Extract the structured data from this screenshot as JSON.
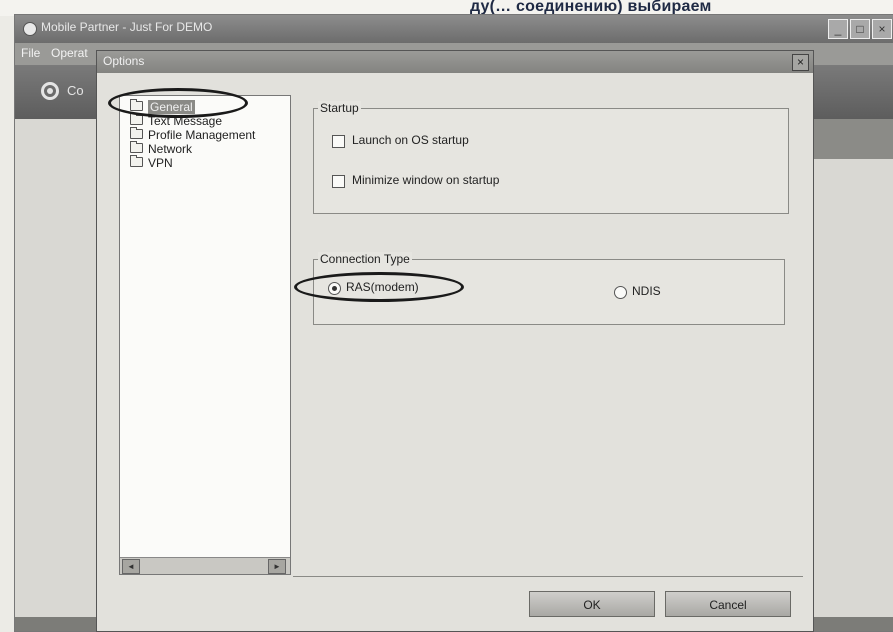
{
  "document": {
    "caption_fragment": "ду(… соединению) выбираем"
  },
  "app": {
    "title": "Mobile Partner - Just For DEMO",
    "menu": [
      "File",
      "Operat"
    ],
    "toolbar_text": "Co",
    "window_controls": [
      "_",
      "□",
      "×"
    ]
  },
  "dialog": {
    "title": "Options",
    "close_label": "×",
    "tree": [
      {
        "label": "General",
        "selected": true
      },
      {
        "label": "Text Message",
        "selected": false
      },
      {
        "label": "Profile Management",
        "selected": false
      },
      {
        "label": "Network",
        "selected": false
      },
      {
        "label": "VPN",
        "selected": false
      }
    ],
    "scroll_left": "◄",
    "scroll_right": "►",
    "startup": {
      "legend": "Startup",
      "launch_on_startup": {
        "label": "Launch on OS startup",
        "checked": false
      },
      "minimize_on_startup": {
        "label": "Minimize window on startup",
        "checked": false
      }
    },
    "connection_type": {
      "legend": "Connection Type",
      "options": [
        {
          "label": "RAS(modem)",
          "selected": true
        },
        {
          "label": "NDIS",
          "selected": false
        }
      ]
    },
    "buttons": {
      "ok": "OK",
      "cancel": "Cancel"
    }
  }
}
